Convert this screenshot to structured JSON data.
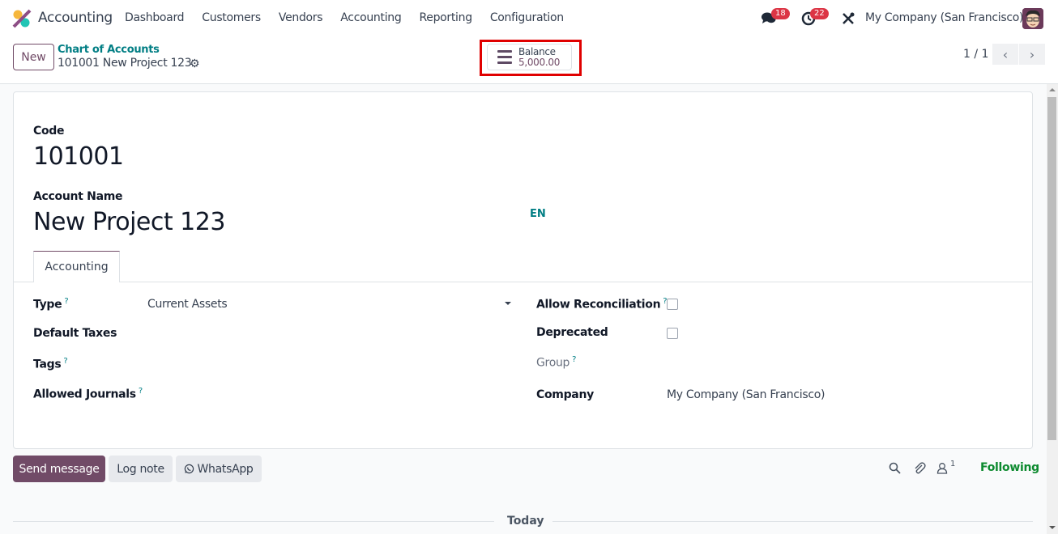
{
  "navbar": {
    "app_name": "Accounting",
    "menu": [
      "Dashboard",
      "Customers",
      "Vendors",
      "Accounting",
      "Reporting",
      "Configuration"
    ],
    "messages_count": "18",
    "activities_count": "22",
    "company": "My Company (San Francisco)"
  },
  "control_panel": {
    "new_label": "New",
    "breadcrumb_parent": "Chart of Accounts",
    "breadcrumb_current": "101001 New Project 123",
    "balance_label": "Balance",
    "balance_value": "5,000.00",
    "pager": "1 / 1"
  },
  "form": {
    "code_label": "Code",
    "code_value": "101001",
    "name_label": "Account Name",
    "name_value": "New Project 123",
    "lang": "EN",
    "tab_label": "Accounting",
    "help_mark": "?",
    "left_fields": [
      {
        "label": "Type",
        "value": "Current Assets",
        "help": true
      },
      {
        "label": "Default Taxes",
        "value": "",
        "help": false
      },
      {
        "label": "Tags",
        "value": "",
        "help": true
      },
      {
        "label": "Allowed Journals",
        "value": "",
        "help": true
      }
    ],
    "right_fields": [
      {
        "label": "Allow Reconciliation",
        "checked": false,
        "help": true
      },
      {
        "label": "Deprecated",
        "checked": false,
        "help": false
      },
      {
        "label": "Group",
        "value": "",
        "help": true
      },
      {
        "label": "Company",
        "value": "My Company (San Francisco)",
        "help": false
      }
    ]
  },
  "chatter": {
    "send_message": "Send message",
    "log_note": "Log note",
    "whatsapp": "WhatsApp",
    "followers_count": "1",
    "following": "Following",
    "date_separator": "Today"
  },
  "colors": {
    "brand": "#714b67",
    "link": "#017e84",
    "following": "#0d8a2f",
    "badge": "#dc3545",
    "highlight": "#e00000"
  }
}
